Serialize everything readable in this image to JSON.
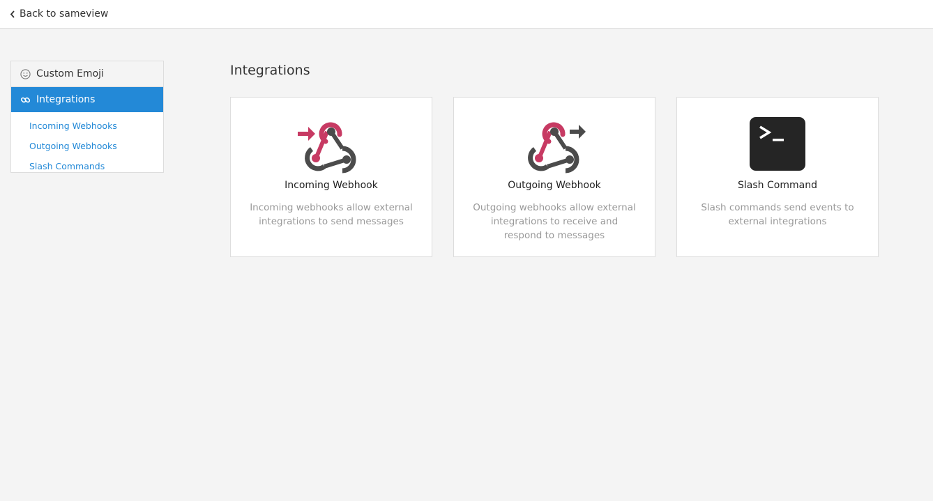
{
  "header": {
    "back_label": "Back to sameview"
  },
  "sidebar": {
    "items": [
      {
        "label": "Custom Emoji",
        "icon": "smiley-icon",
        "active": false
      },
      {
        "label": "Integrations",
        "icon": "link-icon",
        "active": true
      }
    ],
    "subitems": [
      {
        "label": "Incoming Webhooks"
      },
      {
        "label": "Outgoing Webhooks"
      },
      {
        "label": "Slash Commands"
      }
    ]
  },
  "main": {
    "title": "Integrations",
    "cards": [
      {
        "title": "Incoming Webhook",
        "description": "Incoming webhooks allow external integrations to send messages",
        "icon": "incoming-webhook-icon"
      },
      {
        "title": "Outgoing Webhook",
        "description": "Outgoing webhooks allow external integrations to receive and respond to messages",
        "icon": "outgoing-webhook-icon"
      },
      {
        "title": "Slash Command",
        "description": "Slash commands send events to external integrations",
        "icon": "terminal-icon"
      }
    ]
  },
  "colors": {
    "accent": "#2389d7",
    "webhook_red": "#c73a63",
    "webhook_dark": "#4b4b4b",
    "terminal_bg": "#252525"
  }
}
